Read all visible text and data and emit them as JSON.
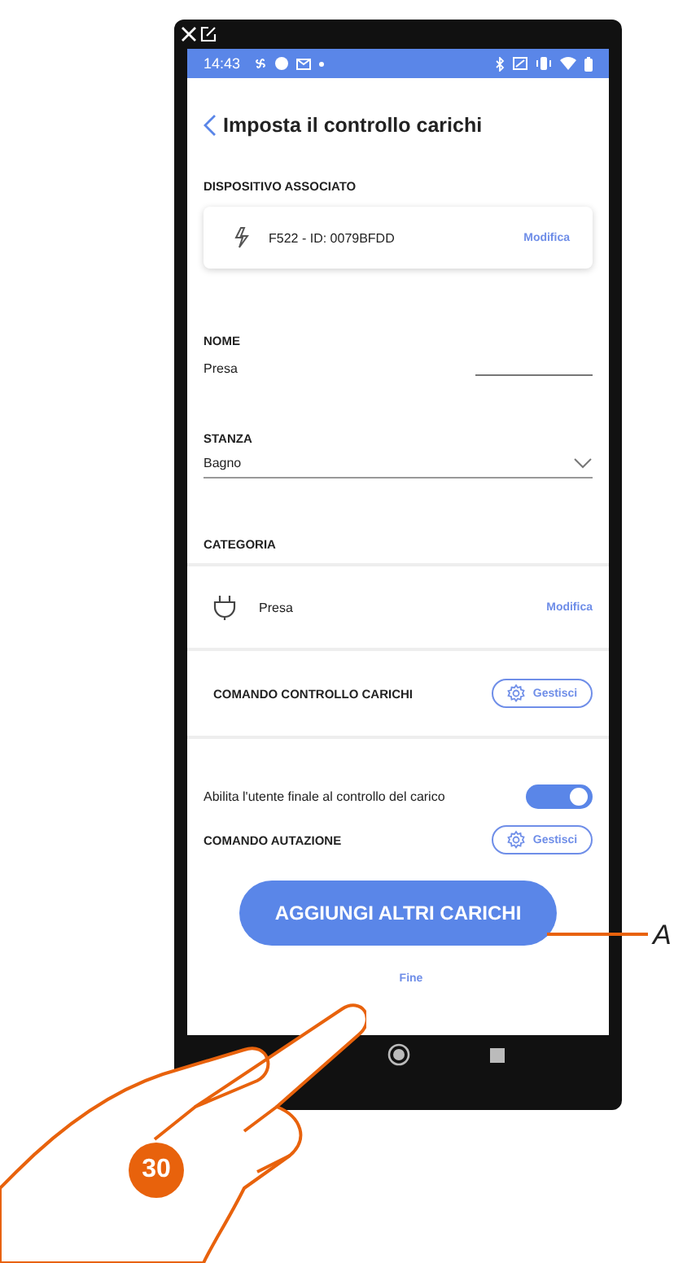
{
  "status_bar": {
    "time": "14:43"
  },
  "header": {
    "title": "Imposta il controllo carichi"
  },
  "device_section": {
    "label": "DISPOSITIVO ASSOCIATO",
    "device": "F522 - ID: 0079BFDD",
    "action": "Modifica"
  },
  "name_field": {
    "label": "NOME",
    "value": "Presa"
  },
  "room_field": {
    "label": "STANZA",
    "value": "Bagno"
  },
  "category_section": {
    "label": "CATEGORIA",
    "value": "Presa",
    "action": "Modifica"
  },
  "load_control": {
    "label": "COMANDO CONTROLLO CARICHI",
    "action": "Gestisci"
  },
  "enable_toggle": {
    "label": "Abilita l'utente finale al controllo del carico",
    "on": true
  },
  "automation": {
    "label": "COMANDO AUTAZIONE",
    "action": "Gestisci"
  },
  "primary_button": "AGGIUNGI ALTRI CARICHI",
  "done_link": "Fine",
  "callout": "A",
  "step_badge": "30"
}
